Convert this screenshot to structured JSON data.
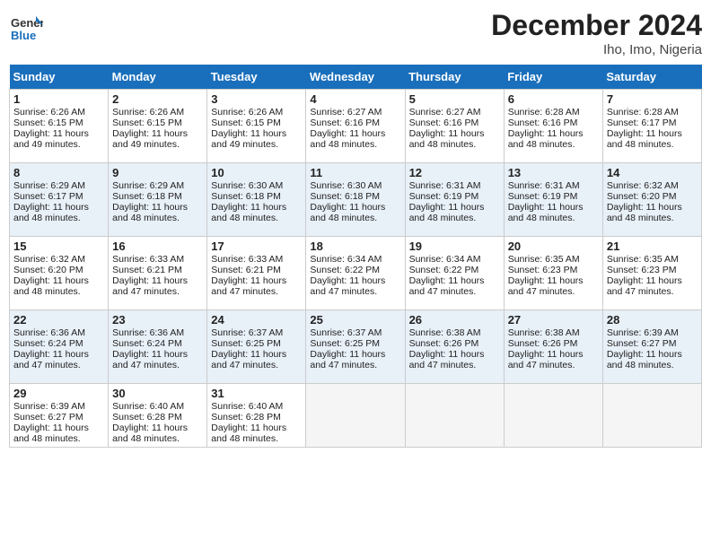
{
  "header": {
    "logo_general": "General",
    "logo_blue": "Blue",
    "month_year": "December 2024",
    "location": "Iho, Imo, Nigeria"
  },
  "weekdays": [
    "Sunday",
    "Monday",
    "Tuesday",
    "Wednesday",
    "Thursday",
    "Friday",
    "Saturday"
  ],
  "weeks": [
    [
      {
        "day": "1",
        "sunrise": "6:26 AM",
        "sunset": "6:15 PM",
        "daylight": "11 hours and 49 minutes."
      },
      {
        "day": "2",
        "sunrise": "6:26 AM",
        "sunset": "6:15 PM",
        "daylight": "11 hours and 49 minutes."
      },
      {
        "day": "3",
        "sunrise": "6:26 AM",
        "sunset": "6:15 PM",
        "daylight": "11 hours and 49 minutes."
      },
      {
        "day": "4",
        "sunrise": "6:27 AM",
        "sunset": "6:16 PM",
        "daylight": "11 hours and 48 minutes."
      },
      {
        "day": "5",
        "sunrise": "6:27 AM",
        "sunset": "6:16 PM",
        "daylight": "11 hours and 48 minutes."
      },
      {
        "day": "6",
        "sunrise": "6:28 AM",
        "sunset": "6:16 PM",
        "daylight": "11 hours and 48 minutes."
      },
      {
        "day": "7",
        "sunrise": "6:28 AM",
        "sunset": "6:17 PM",
        "daylight": "11 hours and 48 minutes."
      }
    ],
    [
      {
        "day": "8",
        "sunrise": "6:29 AM",
        "sunset": "6:17 PM",
        "daylight": "11 hours and 48 minutes."
      },
      {
        "day": "9",
        "sunrise": "6:29 AM",
        "sunset": "6:18 PM",
        "daylight": "11 hours and 48 minutes."
      },
      {
        "day": "10",
        "sunrise": "6:30 AM",
        "sunset": "6:18 PM",
        "daylight": "11 hours and 48 minutes."
      },
      {
        "day": "11",
        "sunrise": "6:30 AM",
        "sunset": "6:18 PM",
        "daylight": "11 hours and 48 minutes."
      },
      {
        "day": "12",
        "sunrise": "6:31 AM",
        "sunset": "6:19 PM",
        "daylight": "11 hours and 48 minutes."
      },
      {
        "day": "13",
        "sunrise": "6:31 AM",
        "sunset": "6:19 PM",
        "daylight": "11 hours and 48 minutes."
      },
      {
        "day": "14",
        "sunrise": "6:32 AM",
        "sunset": "6:20 PM",
        "daylight": "11 hours and 48 minutes."
      }
    ],
    [
      {
        "day": "15",
        "sunrise": "6:32 AM",
        "sunset": "6:20 PM",
        "daylight": "11 hours and 48 minutes."
      },
      {
        "day": "16",
        "sunrise": "6:33 AM",
        "sunset": "6:21 PM",
        "daylight": "11 hours and 47 minutes."
      },
      {
        "day": "17",
        "sunrise": "6:33 AM",
        "sunset": "6:21 PM",
        "daylight": "11 hours and 47 minutes."
      },
      {
        "day": "18",
        "sunrise": "6:34 AM",
        "sunset": "6:22 PM",
        "daylight": "11 hours and 47 minutes."
      },
      {
        "day": "19",
        "sunrise": "6:34 AM",
        "sunset": "6:22 PM",
        "daylight": "11 hours and 47 minutes."
      },
      {
        "day": "20",
        "sunrise": "6:35 AM",
        "sunset": "6:23 PM",
        "daylight": "11 hours and 47 minutes."
      },
      {
        "day": "21",
        "sunrise": "6:35 AM",
        "sunset": "6:23 PM",
        "daylight": "11 hours and 47 minutes."
      }
    ],
    [
      {
        "day": "22",
        "sunrise": "6:36 AM",
        "sunset": "6:24 PM",
        "daylight": "11 hours and 47 minutes."
      },
      {
        "day": "23",
        "sunrise": "6:36 AM",
        "sunset": "6:24 PM",
        "daylight": "11 hours and 47 minutes."
      },
      {
        "day": "24",
        "sunrise": "6:37 AM",
        "sunset": "6:25 PM",
        "daylight": "11 hours and 47 minutes."
      },
      {
        "day": "25",
        "sunrise": "6:37 AM",
        "sunset": "6:25 PM",
        "daylight": "11 hours and 47 minutes."
      },
      {
        "day": "26",
        "sunrise": "6:38 AM",
        "sunset": "6:26 PM",
        "daylight": "11 hours and 47 minutes."
      },
      {
        "day": "27",
        "sunrise": "6:38 AM",
        "sunset": "6:26 PM",
        "daylight": "11 hours and 47 minutes."
      },
      {
        "day": "28",
        "sunrise": "6:39 AM",
        "sunset": "6:27 PM",
        "daylight": "11 hours and 48 minutes."
      }
    ],
    [
      {
        "day": "29",
        "sunrise": "6:39 AM",
        "sunset": "6:27 PM",
        "daylight": "11 hours and 48 minutes."
      },
      {
        "day": "30",
        "sunrise": "6:40 AM",
        "sunset": "6:28 PM",
        "daylight": "11 hours and 48 minutes."
      },
      {
        "day": "31",
        "sunrise": "6:40 AM",
        "sunset": "6:28 PM",
        "daylight": "11 hours and 48 minutes."
      },
      null,
      null,
      null,
      null
    ]
  ]
}
